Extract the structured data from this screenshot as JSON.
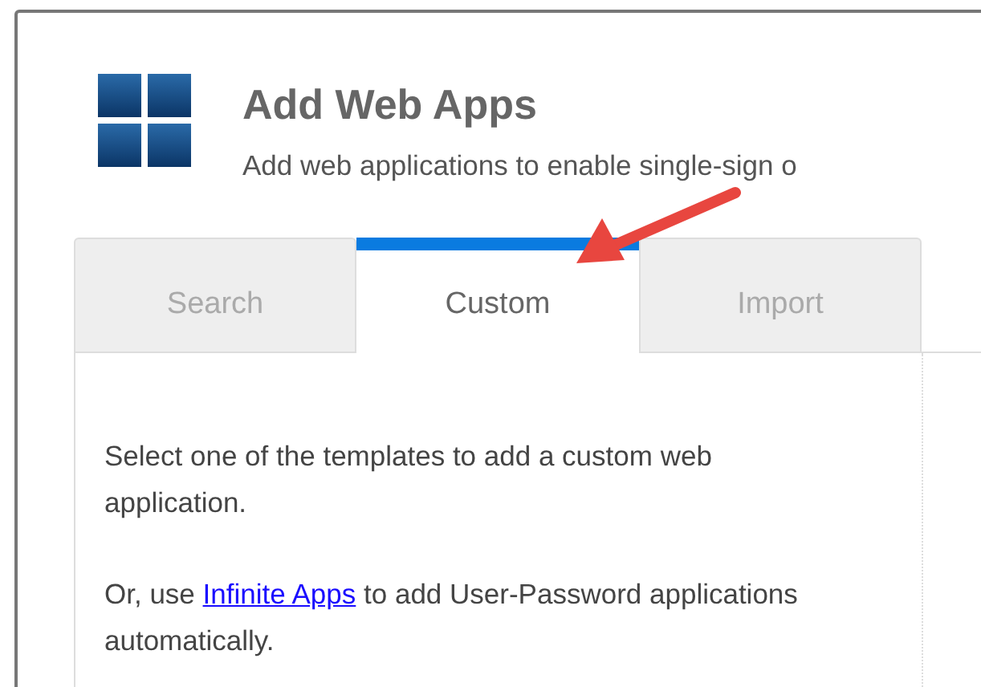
{
  "header": {
    "title": "Add Web Apps",
    "subtitle": "Add web applications to enable single-sign o"
  },
  "tabs": [
    {
      "label": "Search",
      "selected": false
    },
    {
      "label": "Custom",
      "selected": true
    },
    {
      "label": "Import",
      "selected": false
    }
  ],
  "panel": {
    "intro": "Select one of the templates to add a custom web application.",
    "hint_before": "Or, use ",
    "hint_link": "Infinite Apps",
    "hint_after": " to add User-Password applications automatically."
  }
}
